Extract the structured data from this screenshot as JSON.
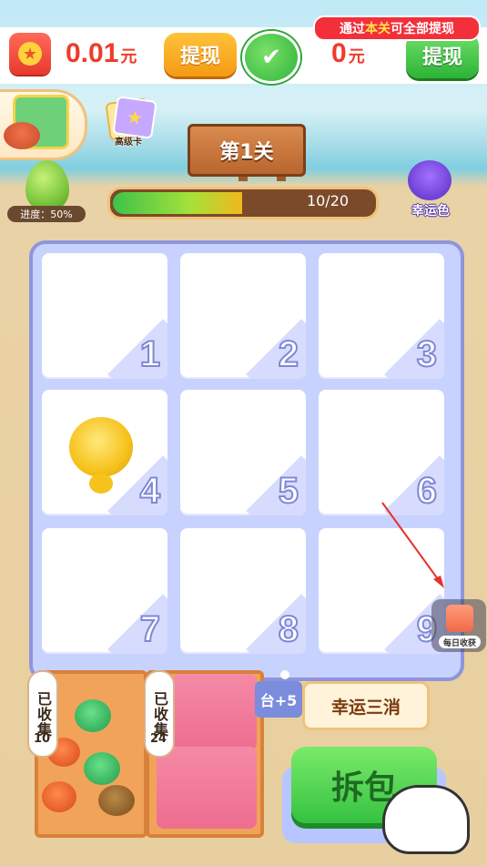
{
  "header": {
    "cash_amount": "0.01",
    "cash_unit": "元",
    "withdraw_label": "提现",
    "wechat_amount": "0",
    "wechat_unit": "元",
    "wechat_withdraw_label": "提现",
    "notice_prefix": "通过",
    "notice_highlight": "本关",
    "notice_suffix": "可全部提现"
  },
  "left_panel": {
    "card_label": "高级卡",
    "progress_label": "进度：50%"
  },
  "level": {
    "title": "第1关",
    "progress_text": "10/20",
    "progress_value": 0.5,
    "lucky_color_label": "幸运色"
  },
  "board": {
    "cells": [
      {
        "number": "1",
        "item": ""
      },
      {
        "number": "2",
        "item": ""
      },
      {
        "number": "3",
        "item": ""
      },
      {
        "number": "4",
        "item": "yellow-turtle"
      },
      {
        "number": "5",
        "item": ""
      },
      {
        "number": "6",
        "item": ""
      },
      {
        "number": "7",
        "item": ""
      },
      {
        "number": "8",
        "item": ""
      },
      {
        "number": "9",
        "item": ""
      }
    ]
  },
  "bottom": {
    "collected_label": "已收集",
    "turtles_collected": "10",
    "packs_collected": "24",
    "plus_label": "台+5",
    "lucky_triple_label": "幸运三消",
    "unpack_label": "拆包",
    "daily_label": "每日收获"
  },
  "colors": {
    "accent_red": "#ef3b2a",
    "green_button": "#35c241",
    "board_border": "#8e95dc",
    "board_bg": "#c8d2ff"
  }
}
